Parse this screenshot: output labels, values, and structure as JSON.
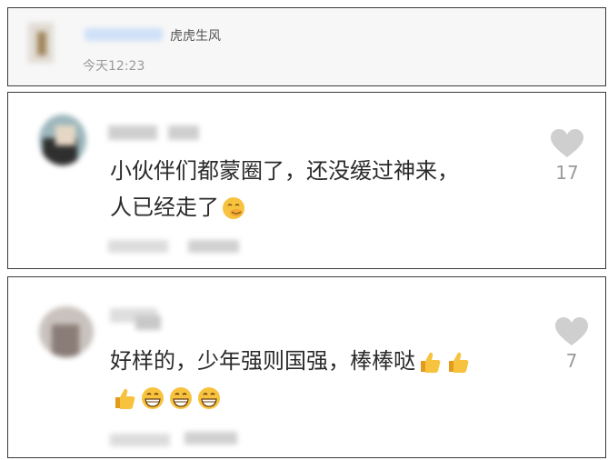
{
  "header_card": {
    "title": "虎虎生风",
    "time": "今天12:23"
  },
  "comments": [
    {
      "lines": [
        "小伙伴们都蒙圈了，还没缓过神来，",
        "人已经走了"
      ],
      "emoji_end": [
        "face-emoji"
      ],
      "like_count": "17"
    },
    {
      "lines": [
        "好样的，少年强则国强，棒棒哒",
        ""
      ],
      "emoji_line1": [
        "thumbs-up-emoji",
        "thumbs-up-emoji"
      ],
      "emoji_line2": [
        "thumbs-up-emoji",
        "grin-emoji",
        "grin-emoji",
        "grin-emoji"
      ],
      "like_count": "7"
    }
  ],
  "colors": {
    "text": "#2a2a2a",
    "muted": "#9a9a9a",
    "heart": "#cfcfcf",
    "emoji_yellow": "#f7c33f",
    "border": "#3a3a3a"
  }
}
